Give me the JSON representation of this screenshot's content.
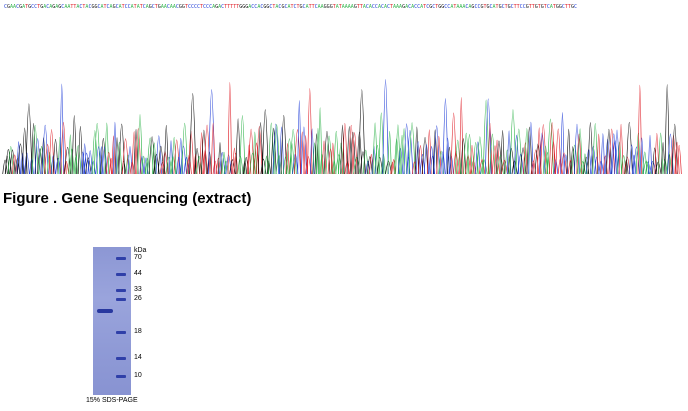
{
  "figure_caption": "Figure . Gene Sequencing (extract)",
  "gel": {
    "unit_label": "kDa",
    "markers": [
      "70",
      "44",
      "33",
      "26",
      "18",
      "14",
      "10"
    ],
    "caption": "15% SDS-PAGE"
  },
  "colors": {
    "trace_A": "#2fb34a",
    "trace_C": "#2340d8",
    "trace_G": "#111111",
    "trace_T": "#e0232c"
  }
}
